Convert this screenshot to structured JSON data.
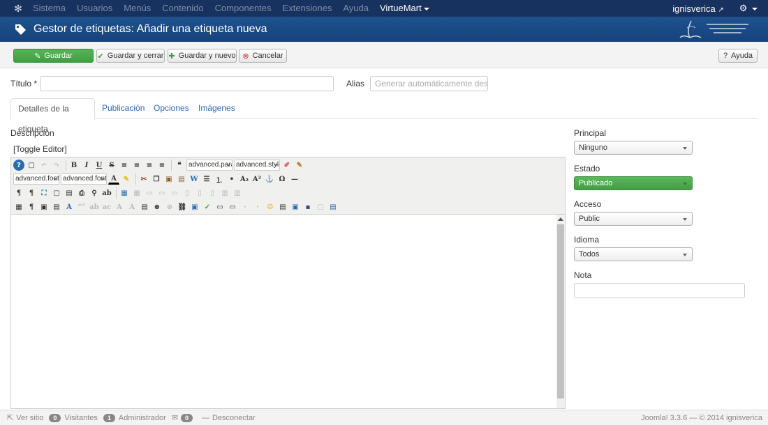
{
  "navbar": {
    "menu": [
      "Sistema",
      "Usuarios",
      "Menús",
      "Contenido",
      "Componentes",
      "Extensiones",
      "Ayuda",
      "VirtueMart"
    ],
    "user": "ignisverica"
  },
  "header": {
    "title": "Gestor de etiquetas: Añadir una etiqueta nueva"
  },
  "toolbar": {
    "save": "Guardar",
    "save_close": "Guardar y cerrar",
    "save_new": "Guardar y nuevo",
    "cancel": "Cancelar",
    "help": "Ayuda"
  },
  "form": {
    "title_label": "Título *",
    "title_value": "",
    "alias_label": "Alias",
    "alias_placeholder": "Generar automáticamente desde el"
  },
  "tabs": [
    "Detalles de la etiqueta",
    "Publicación",
    "Opciones",
    "Imágenes"
  ],
  "editor": {
    "description_label": "Descripción",
    "toggle": "[Toggle Editor]",
    "select_para": "advanced.para",
    "select_style": "advanced.style",
    "select_font1": "advanced.font",
    "select_font2": "advanced.font"
  },
  "sidebar": {
    "parent_label": "Principal",
    "parent_value": "Ninguno",
    "state_label": "Estado",
    "state_value": "Publicado",
    "access_label": "Acceso",
    "access_value": "Public",
    "language_label": "Idioma",
    "language_value": "Todos",
    "note_label": "Nota",
    "note_value": ""
  },
  "footer": {
    "view_site": "Ver sitio",
    "visitors_count": "0",
    "visitors": "Visitantes",
    "admin_count": "1",
    "admin": "Administrador",
    "messages_count": "0",
    "logout": "Desconectar",
    "version": "Joomla! 3.3.6",
    "copyright": "© 2014 ignisverica"
  },
  "colors": {
    "navbar": "#17325e",
    "header": "#1c4a85",
    "save_green": "#46a546",
    "link_blue": "#2a69b8"
  }
}
